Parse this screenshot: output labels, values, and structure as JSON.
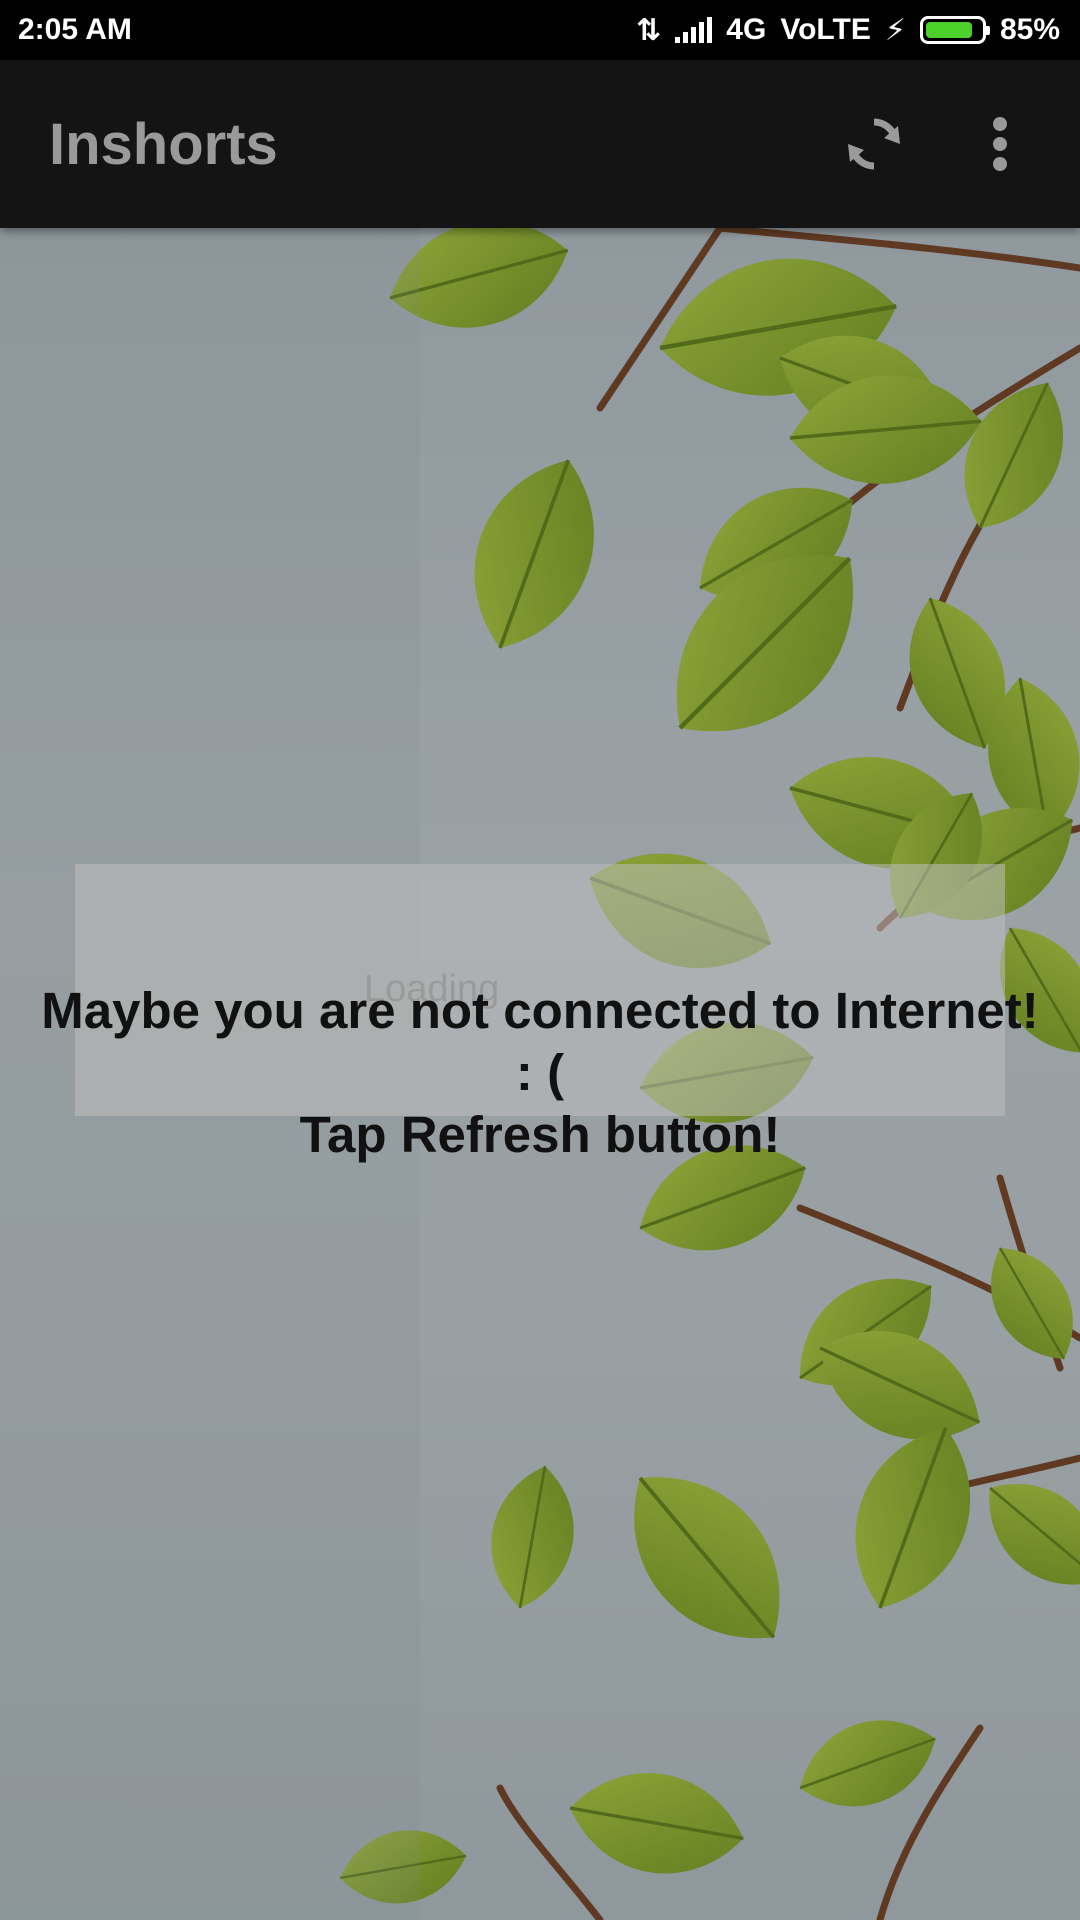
{
  "status_bar": {
    "time": "2:05 AM",
    "network": "4G",
    "volte": "VoLTE",
    "battery_percent": "85%",
    "battery_level": 0.85,
    "battery_color": "#4cd12a"
  },
  "app_bar": {
    "title": "Inshorts",
    "refresh_icon": "refresh-icon",
    "menu_icon": "more-vert-icon"
  },
  "main": {
    "loading_text": "Loading",
    "error_line1": "Maybe you are not connected to Internet!",
    "error_line2": ": (",
    "error_line3": "Tap Refresh button!"
  },
  "colors": {
    "app_bar": "#141414",
    "title": "#9a9a9a",
    "leaf": "#8fb62e"
  }
}
